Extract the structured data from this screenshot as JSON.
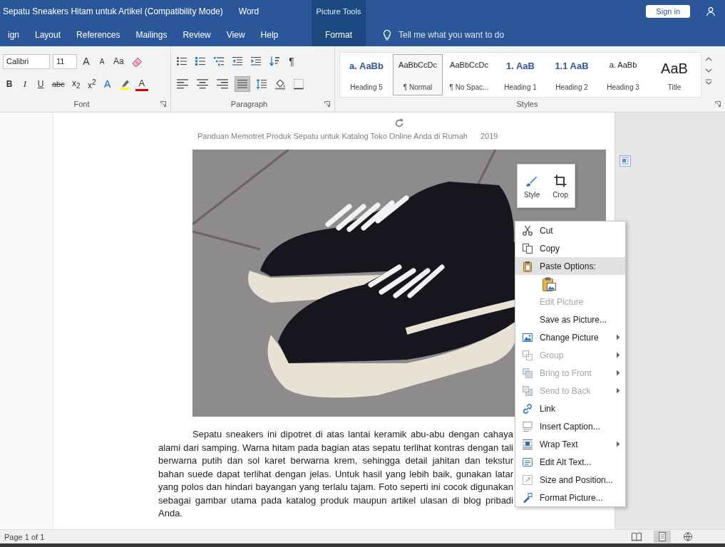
{
  "window": {
    "title": "Sepatu Sneakers Hitam untuk Artikel (Compatibility Mode)",
    "app": "Word",
    "context_group": "Picture Tools",
    "account_button": "Sign in"
  },
  "tabs": [
    {
      "label": "ign",
      "kind": "standard",
      "selected": false
    },
    {
      "label": "Layout",
      "kind": "standard",
      "selected": false
    },
    {
      "label": "References",
      "kind": "standard",
      "selected": false
    },
    {
      "label": "Mailings",
      "kind": "standard",
      "selected": false
    },
    {
      "label": "Review",
      "kind": "standard",
      "selected": false
    },
    {
      "label": "View",
      "kind": "standard",
      "selected": false
    },
    {
      "label": "Help",
      "kind": "standard",
      "selected": false
    },
    {
      "label": "Format",
      "kind": "contextual",
      "selected": true
    }
  ],
  "tell_me": {
    "placeholder": "Tell me what you want to do"
  },
  "ribbon": {
    "font": {
      "label": "Font",
      "name": "Calibri",
      "size": "11",
      "case_buttons": [
        "A",
        "A",
        "Aa"
      ],
      "format_buttons": [
        "B",
        "I",
        "U",
        "abc",
        "x$_{2}$",
        "x$^{2}$"
      ],
      "text_effects": "A",
      "font_color": "A"
    },
    "paragraph": {
      "label": "Paragraph",
      "show_marks": "¶",
      "alignment": [
        {
          "selected": false
        },
        {
          "selected": false
        },
        {
          "selected": false
        },
        {
          "selected": true
        }
      ]
    },
    "styles": {
      "label": "Styles",
      "items": [
        {
          "preview": "a. AaBb",
          "label": "Heading 5",
          "kind": "heading",
          "selected": false
        },
        {
          "preview": "AaBbCcDc",
          "label": "¶ Normal",
          "kind": "normal",
          "selected": true
        },
        {
          "preview": "AaBbCcDc",
          "label": "¶ No Spac...",
          "kind": "normal",
          "selected": false
        },
        {
          "preview": "1. AaB",
          "label": "Heading 1",
          "kind": "heading",
          "selected": false
        },
        {
          "preview": "1.1 AaB",
          "label": "Heading 2",
          "kind": "heading",
          "selected": false
        },
        {
          "preview": "a. AaBb",
          "label": "Heading 3",
          "kind": "normal",
          "selected": false
        },
        {
          "preview": "AaB",
          "label": "Title",
          "kind": "title",
          "selected": false
        }
      ]
    }
  },
  "document": {
    "header": "Panduan Memotret Produk Sepatu untuk Katalog Toko Online Anda di Rumah",
    "header_year": "2019",
    "mini_toolbar": [
      {
        "label": "Style"
      },
      {
        "label": "Crop"
      }
    ],
    "body": "Sepatu sneakers ini dipotret di atas lantai keramik abu-abu dengan cahaya alami dari samping. Warna hitam pada bagian atas sepatu terlihat kontras dengan tali berwarna putih dan sol karet berwarna krem, sehingga detail jahitan dan tekstur bahan suede dapat terlihat dengan jelas. Untuk hasil yang lebih baik, gunakan latar yang polos dan hindari bayangan yang terlalu tajam. Foto seperti ini cocok digunakan sebagai gambar utama pada katalog produk maupun artikel ulasan di blog pribadi Anda."
  },
  "context_menu": [
    {
      "kind": "command",
      "label": "Cut",
      "disabled": false,
      "selected": false,
      "submenu": false
    },
    {
      "kind": "command",
      "label": "Copy",
      "disabled": false,
      "selected": false,
      "submenu": false
    },
    {
      "kind": "command",
      "label": "Paste Options:",
      "disabled": false,
      "selected": true,
      "submenu": false
    },
    {
      "kind": "paste_row"
    },
    {
      "kind": "command",
      "label": "Edit Picture",
      "disabled": true,
      "selected": false,
      "submenu": false
    },
    {
      "kind": "command",
      "label": "Save as Picture...",
      "disabled": false,
      "selected": false,
      "submenu": false
    },
    {
      "kind": "command",
      "label": "Change Picture",
      "disabled": false,
      "selected": false,
      "submenu": true
    },
    {
      "kind": "command",
      "label": "Group",
      "disabled": true,
      "selected": false,
      "submenu": true
    },
    {
      "kind": "command",
      "label": "Bring to Front",
      "disabled": true,
      "selected": false,
      "submenu": true
    },
    {
      "kind": "command",
      "label": "Send to Back",
      "disabled": true,
      "selected": false,
      "submenu": true
    },
    {
      "kind": "command",
      "label": "Link",
      "disabled": false,
      "selected": false,
      "submenu": false
    },
    {
      "kind": "command",
      "label": "Insert Caption...",
      "disabled": false,
      "selected": false,
      "submenu": false
    },
    {
      "kind": "command",
      "label": "Wrap Text",
      "disabled": false,
      "selected": false,
      "submenu": true
    },
    {
      "kind": "command",
      "label": "Edit Alt Text...",
      "disabled": false,
      "selected": false,
      "submenu": false
    },
    {
      "kind": "command",
      "label": "Size and Position...",
      "disabled": false,
      "selected": false,
      "submenu": false
    },
    {
      "kind": "command",
      "label": "Format Picture...",
      "disabled": false,
      "selected": false,
      "submenu": false
    }
  ],
  "status_bar": {
    "page": "Page 1 of 1",
    "views": [
      {
        "selected": false
      },
      {
        "selected": true
      },
      {
        "selected": false
      }
    ]
  }
}
